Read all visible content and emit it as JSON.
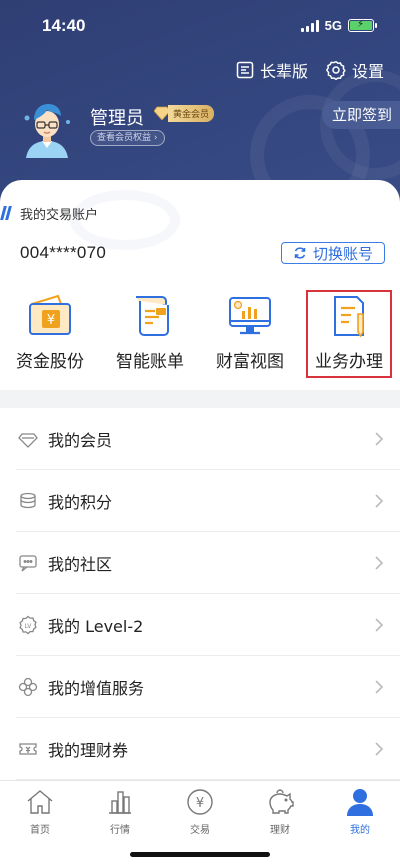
{
  "status_bar": {
    "time": "14:40",
    "network": "5G"
  },
  "header": {
    "elder_mode_label": "长辈版",
    "settings_label": "设置",
    "user_name": "管理员",
    "member_level": "黄金会员",
    "member_rights_link": "查看会员权益",
    "signin_label": "立即签到"
  },
  "account": {
    "title": "我的交易账户",
    "number": "004****070",
    "switch_label": "切换账号"
  },
  "quick_actions": [
    {
      "label": "资金股份",
      "icon": "wallet-yuan-icon"
    },
    {
      "label": "智能账单",
      "icon": "bill-scroll-icon"
    },
    {
      "label": "财富视图",
      "icon": "monitor-chart-icon"
    },
    {
      "label": "业务办理",
      "icon": "document-pen-icon",
      "highlighted": true
    }
  ],
  "menu": [
    {
      "label": "我的会员",
      "icon": "diamond-icon"
    },
    {
      "label": "我的积分",
      "icon": "coins-stack-icon"
    },
    {
      "label": "我的社区",
      "icon": "chat-icon"
    },
    {
      "label": "我的 Level-2",
      "icon": "lv-badge-icon"
    },
    {
      "label": "我的增值服务",
      "icon": "clover-icon"
    },
    {
      "label": "我的理财券",
      "icon": "coupon-icon"
    }
  ],
  "tabbar": [
    {
      "label": "首页",
      "icon": "home-icon"
    },
    {
      "label": "行情",
      "icon": "market-chart-icon"
    },
    {
      "label": "交易",
      "icon": "yuan-coin-icon"
    },
    {
      "label": "理财",
      "icon": "piggy-bank-icon"
    },
    {
      "label": "我的",
      "icon": "person-icon",
      "active": true
    }
  ],
  "colors": {
    "header_bg": "#34467f",
    "accent": "#2f6fe0",
    "highlight_box": "#d8323a",
    "gold": "#f0a21f"
  }
}
